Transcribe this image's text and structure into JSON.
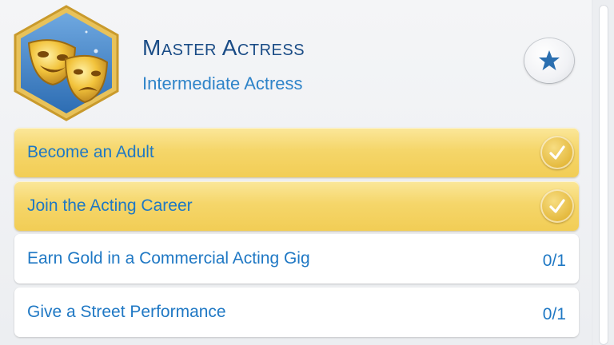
{
  "aspiration": {
    "title": "Master Actress",
    "subtitle": "Intermediate Actress",
    "badge_icon": "theater-masks-icon",
    "track_icon": "star-icon"
  },
  "milestones": [
    {
      "label": "Become an Adult",
      "status": "complete",
      "icon": "checkmark-icon"
    },
    {
      "label": "Join the Acting Career",
      "status": "complete",
      "icon": "checkmark-icon"
    },
    {
      "label": "Earn Gold in a Commercial Acting Gig",
      "status": "incomplete",
      "progress": "0/1"
    },
    {
      "label": "Give a Street Performance",
      "status": "incomplete",
      "progress": "0/1"
    }
  ],
  "colors": {
    "title": "#1a4c86",
    "text": "#1f78c4",
    "complete_fill": "#f5d66a",
    "badge_hex": "#4a86c8"
  }
}
